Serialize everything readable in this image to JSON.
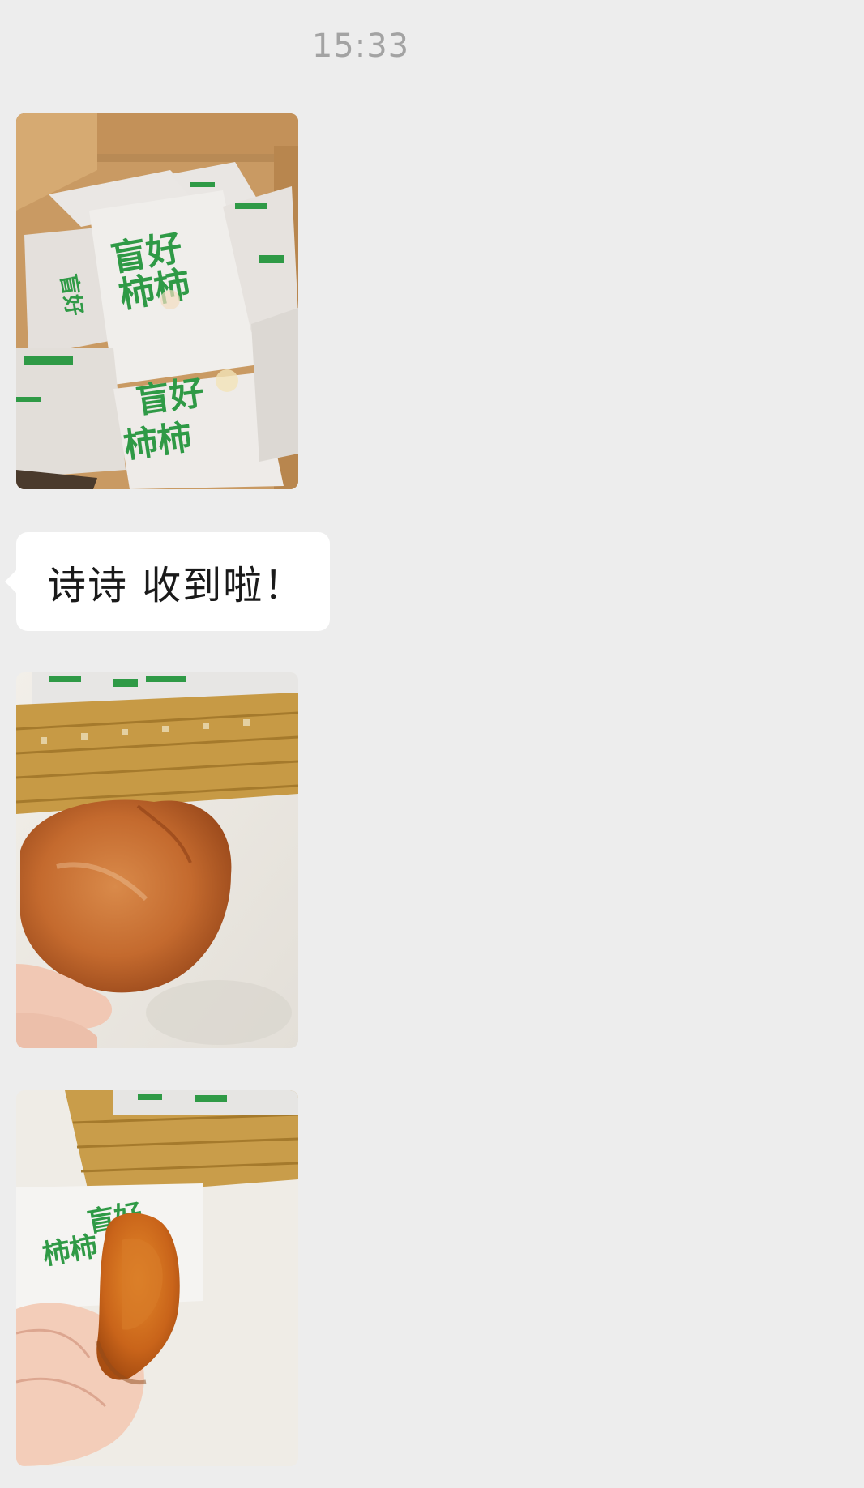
{
  "chat": {
    "timestamp": "15:33",
    "messages": [
      {
        "type": "image",
        "description_tag": "photo-box-of-wrapped-persimmons",
        "package_text": "盲好柿柿"
      },
      {
        "type": "text",
        "text": "诗诗 收到啦！"
      },
      {
        "type": "image",
        "description_tag": "photo-dried-persimmon-in-hand"
      },
      {
        "type": "image",
        "description_tag": "photo-bitten-persimmon-in-hand",
        "package_text": "盲好柿柿"
      }
    ]
  },
  "colors": {
    "background": "#ededed",
    "bubble": "#ffffff",
    "timestamp": "#a3a3a3",
    "text": "#1a1a1a"
  }
}
